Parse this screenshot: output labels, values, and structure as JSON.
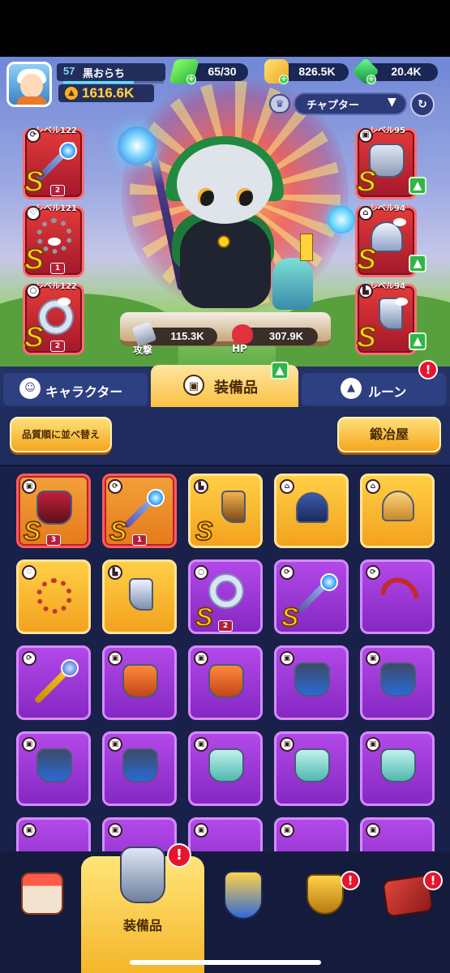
{
  "player": {
    "level": "57",
    "name": "黒おらち",
    "power": "1616.6K",
    "xp_fraction": 0.7
  },
  "resources": {
    "energy": "65/30",
    "gold": "826.5K",
    "gems": "20.4K"
  },
  "chapter": {
    "label": "チャプター"
  },
  "equipped_left": [
    {
      "name": "staff",
      "level_label": "レベル122",
      "grade": "S",
      "stars": "2"
    },
    {
      "name": "necklace",
      "level_label": "レベル121",
      "grade": "S",
      "stars": "1"
    },
    {
      "name": "ring",
      "level_label": "レベル122",
      "grade": "S",
      "stars": "2"
    }
  ],
  "equipped_right": [
    {
      "name": "armor",
      "level_label": "レベル95",
      "grade": "S",
      "upgradable": true
    },
    {
      "name": "helmet",
      "level_label": "レベル94",
      "grade": "S",
      "upgradable": true
    },
    {
      "name": "boots",
      "level_label": "レベル94",
      "grade": "S",
      "upgradable": true
    }
  ],
  "stats": {
    "attack_label": "攻撃",
    "attack_value": "115.3K",
    "hp_label": "HP",
    "hp_value": "307.9K"
  },
  "tabs": [
    {
      "label": "キャラクター",
      "active": false
    },
    {
      "label": "装備品",
      "active": true,
      "upgrade": true
    },
    {
      "label": "ルーン",
      "active": false,
      "notification": "!"
    }
  ],
  "actions": {
    "sort_label": "品質順に並べ替え",
    "smith_label": "鍛冶屋"
  },
  "inventory": [
    {
      "item": "armor",
      "rarity": "red",
      "grade": "S",
      "stars": "3"
    },
    {
      "item": "staff",
      "rarity": "red",
      "grade": "S",
      "stars": "1"
    },
    {
      "item": "boots",
      "rarity": "gold",
      "grade": "S"
    },
    {
      "item": "mask-helmet",
      "rarity": "gold"
    },
    {
      "item": "helmet",
      "rarity": "gold"
    },
    {
      "item": "necklace",
      "rarity": "gold"
    },
    {
      "item": "boots",
      "rarity": "gold"
    },
    {
      "item": "ring",
      "rarity": "purple",
      "grade": "S",
      "stars": "2"
    },
    {
      "item": "staff",
      "rarity": "purple",
      "grade": "S"
    },
    {
      "item": "bow",
      "rarity": "purple"
    },
    {
      "item": "scepter",
      "rarity": "purple"
    },
    {
      "item": "armor",
      "rarity": "purple"
    },
    {
      "item": "armor",
      "rarity": "purple"
    },
    {
      "item": "cape-armor",
      "rarity": "purple"
    },
    {
      "item": "cape-armor",
      "rarity": "purple"
    },
    {
      "item": "cape-armor",
      "rarity": "purple"
    },
    {
      "item": "cape-armor",
      "rarity": "purple"
    },
    {
      "item": "vest",
      "rarity": "purple"
    },
    {
      "item": "vest",
      "rarity": "purple"
    },
    {
      "item": "vest",
      "rarity": "purple"
    }
  ],
  "nav": {
    "equipment_label": "装備品",
    "notification": "!"
  },
  "colors": {
    "rarity_red": "#e23a3a",
    "rarity_gold": "#f9c142",
    "rarity_purple": "#9b3ad6",
    "grade_s": "#ffd21e",
    "upgrade_green": "#2fb548",
    "notification_red": "#e8142e"
  }
}
